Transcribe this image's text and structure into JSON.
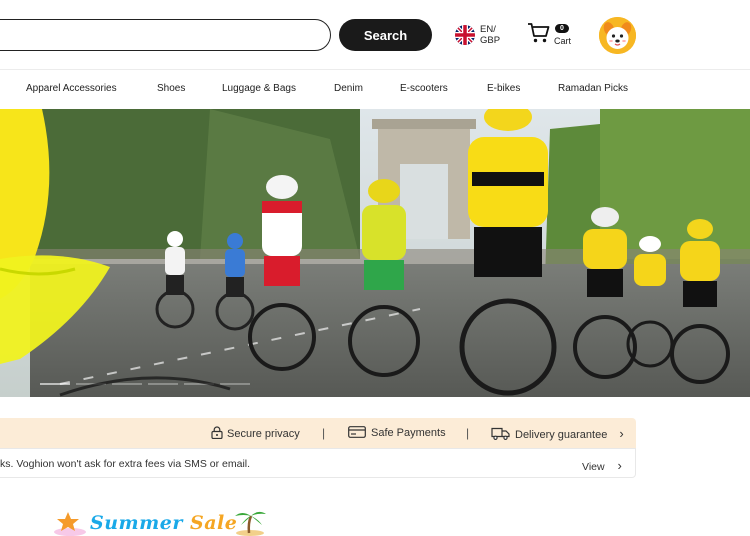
{
  "header": {
    "search": {
      "placeholder": "",
      "value": ""
    },
    "search_button": "Search",
    "language": {
      "lang": "EN/",
      "currency": "GBP",
      "flag_icon": "uk-flag-icon"
    },
    "cart": {
      "count": "0",
      "label": "Cart"
    },
    "avatar_icon": "dog-avatar-icon"
  },
  "nav": {
    "items": [
      "Apparel Accessories",
      "Shoes",
      "Luggage & Bags",
      "Denim",
      "E-scooters",
      "E-bikes",
      "Ramadan Picks"
    ]
  },
  "trust": {
    "items": [
      "Secure privacy",
      "Safe Payments",
      "Delivery guarantee"
    ],
    "separator": "|",
    "arrow": "›"
  },
  "notice": {
    "text": "ks. Voghion won't ask for extra fees via SMS or email.",
    "link": "View",
    "arrow": "›"
  },
  "promo": {
    "summer": "Summer",
    "sale": "Sale"
  },
  "colors": {
    "accent_dark": "#1a1a1a",
    "trust_bg": "#fcecd7",
    "banner_yellow": "#f7e51a",
    "summer_blue": "#1aa9e8",
    "sale_orange": "#f5a623"
  }
}
